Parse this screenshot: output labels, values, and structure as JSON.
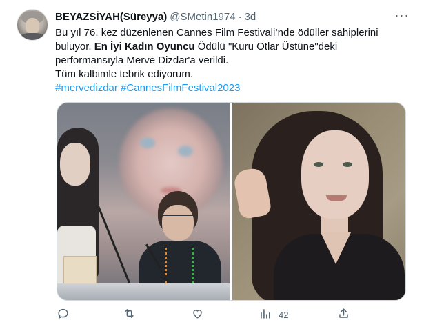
{
  "tweet": {
    "author_name": "BEYAZSİYAH(Süreyya)",
    "handle": "@SMetin1974",
    "separator": "·",
    "time": "3d",
    "more_label": "···",
    "text": {
      "part1": "Bu yıl 76. kez düzenlenen Cannes Film Festivali’nde ödüller sahiplerini buluyor. ",
      "bold": "En İyi Kadın Oyuncu",
      "part2": " Ödülü \"Kuru Otlar Üstüne\"deki performansıyla Merve Dizdar'a verildi.",
      "line2": "Tüm kalbimle tebrik ediyorum.",
      "hashtag1": "#mervedizdar",
      "hashtag2": "#CannesFilmFestival2023"
    }
  },
  "media": [
    {
      "icon": "photo-award-ceremony"
    },
    {
      "icon": "photo-portrait"
    }
  ],
  "actions": {
    "reply_icon": "reply-icon",
    "retweet_icon": "retweet-icon",
    "like_icon": "heart-icon",
    "views_icon": "analytics-icon",
    "views_count": "42",
    "share_icon": "share-icon"
  },
  "colors": {
    "link": "#1d9bf0",
    "secondary_text": "#536471",
    "primary_text": "#0f1419"
  }
}
